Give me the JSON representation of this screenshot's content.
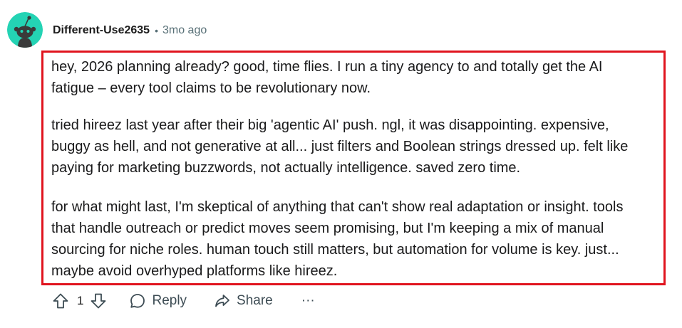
{
  "comment": {
    "author": "Different-Use2635",
    "separator": "•",
    "age": "3mo ago",
    "paragraphs": [
      [
        "hey, 2026 planning already? good, time flies. I run a tiny agency to and totally get the AI",
        "fatigue – every tool claims to be revolutionary now."
      ],
      [
        "tried hireez last year after their big 'agentic AI' push. ngl, it was disappointing. expensive,",
        "buggy as hell, and not generative at all... just filters and Boolean strings dressed up. felt like",
        "paying for marketing buzzwords, not actually intelligence. saved zero time."
      ],
      [
        "for what might last, I'm skeptical of anything that can't show real adaptation or insight. tools",
        "that handle outreach or predict moves seem promising, but I'm keeping a mix of manual",
        "sourcing for niche roles. human touch still matters, but automation for volume is key. just...",
        "maybe avoid overhyped platforms like hireez."
      ]
    ],
    "score": "1",
    "actions": {
      "reply_label": "Reply",
      "share_label": "Share",
      "more_label": "···"
    },
    "icons": {
      "upvote": "upvote-arrow-icon",
      "downvote": "downvote-arrow-icon",
      "reply": "speech-bubble-icon",
      "share": "share-arrow-icon",
      "avatar": "snoo-avatar-icon"
    },
    "colors": {
      "avatar_bg": "#24d3b4",
      "highlight_border": "#e0141e",
      "meta_text": "#576f76",
      "action_text": "#3d4c54"
    }
  }
}
